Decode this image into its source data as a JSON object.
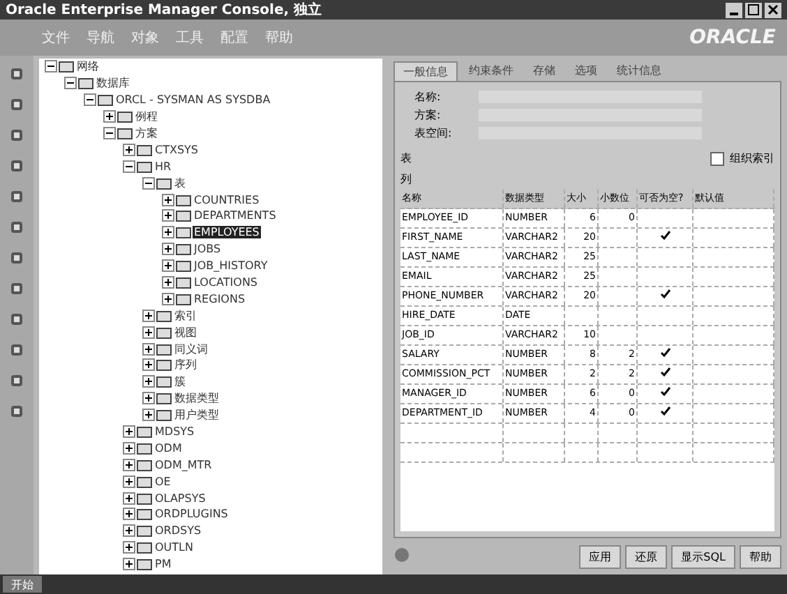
{
  "window": {
    "title": "Oracle Enterprise Manager Console, 独立"
  },
  "menu": [
    "文件",
    "导航",
    "对象",
    "工具",
    "配置",
    "帮助"
  ],
  "logo": "ORACLE",
  "tree": [
    {
      "label": "网络",
      "expanded": true,
      "selected": false,
      "children": [
        {
          "label": "数据库",
          "expanded": true,
          "selected": false,
          "children": [
            {
              "label": "ORCL - SYSMAN AS SYSDBA",
              "expanded": true,
              "selected": false,
              "children": [
                {
                  "label": "例程",
                  "expanded": false,
                  "selected": false
                },
                {
                  "label": "方案",
                  "expanded": true,
                  "selected": false,
                  "children": [
                    {
                      "label": "CTXSYS",
                      "expanded": false,
                      "selected": false
                    },
                    {
                      "label": "HR",
                      "expanded": true,
                      "selected": false,
                      "children": [
                        {
                          "label": "表",
                          "expanded": true,
                          "selected": false,
                          "children": [
                            {
                              "label": "COUNTRIES",
                              "expanded": false,
                              "selected": false
                            },
                            {
                              "label": "DEPARTMENTS",
                              "expanded": false,
                              "selected": false
                            },
                            {
                              "label": "EMPLOYEES",
                              "expanded": false,
                              "selected": true
                            },
                            {
                              "label": "JOBS",
                              "expanded": false,
                              "selected": false
                            },
                            {
                              "label": "JOB_HISTORY",
                              "expanded": false,
                              "selected": false
                            },
                            {
                              "label": "LOCATIONS",
                              "expanded": false,
                              "selected": false
                            },
                            {
                              "label": "REGIONS",
                              "expanded": false,
                              "selected": false
                            }
                          ]
                        },
                        {
                          "label": "索引",
                          "expanded": false,
                          "selected": false
                        },
                        {
                          "label": "视图",
                          "expanded": false,
                          "selected": false
                        },
                        {
                          "label": "同义词",
                          "expanded": false,
                          "selected": false
                        },
                        {
                          "label": "序列",
                          "expanded": false,
                          "selected": false
                        },
                        {
                          "label": "簇",
                          "expanded": false,
                          "selected": false
                        },
                        {
                          "label": "数据类型",
                          "expanded": false,
                          "selected": false
                        },
                        {
                          "label": "用户类型",
                          "expanded": false,
                          "selected": false
                        }
                      ]
                    },
                    {
                      "label": "MDSYS",
                      "expanded": false,
                      "selected": false
                    },
                    {
                      "label": "ODM",
                      "expanded": false,
                      "selected": false
                    },
                    {
                      "label": "ODM_MTR",
                      "expanded": false,
                      "selected": false
                    },
                    {
                      "label": "OE",
                      "expanded": false,
                      "selected": false
                    },
                    {
                      "label": "OLAPSYS",
                      "expanded": false,
                      "selected": false
                    },
                    {
                      "label": "ORDPLUGINS",
                      "expanded": false,
                      "selected": false
                    },
                    {
                      "label": "ORDSYS",
                      "expanded": false,
                      "selected": false
                    },
                    {
                      "label": "OUTLN",
                      "expanded": false,
                      "selected": false
                    },
                    {
                      "label": "PM",
                      "expanded": false,
                      "selected": false
                    }
                  ]
                }
              ]
            }
          ]
        }
      ]
    }
  ],
  "tabs": [
    {
      "label": "一般信息",
      "selected": true
    },
    {
      "label": "约束条件",
      "selected": false
    },
    {
      "label": "存储",
      "selected": false
    },
    {
      "label": "选项",
      "selected": false
    },
    {
      "label": "统计信息",
      "selected": false
    }
  ],
  "fields": [
    {
      "label": "名称:"
    },
    {
      "label": "方案:"
    },
    {
      "label": "表空间:"
    }
  ],
  "section_label": "表",
  "columns_label": "列",
  "org_checkbox": {
    "label": "组织索引",
    "checked": false
  },
  "table": {
    "columns": [
      "名称",
      "数据类型",
      "大小",
      "小数位",
      "可否为空?",
      "默认值"
    ],
    "rows": [
      {
        "name": "EMPLOYEE_ID",
        "type": "NUMBER",
        "size": "6",
        "scale": "0",
        "nullable": false
      },
      {
        "name": "FIRST_NAME",
        "type": "VARCHAR2",
        "size": "20",
        "scale": "",
        "nullable": true
      },
      {
        "name": "LAST_NAME",
        "type": "VARCHAR2",
        "size": "25",
        "scale": "",
        "nullable": false
      },
      {
        "name": "EMAIL",
        "type": "VARCHAR2",
        "size": "25",
        "scale": "",
        "nullable": false
      },
      {
        "name": "PHONE_NUMBER",
        "type": "VARCHAR2",
        "size": "20",
        "scale": "",
        "nullable": true
      },
      {
        "name": "HIRE_DATE",
        "type": "DATE",
        "size": "",
        "scale": "",
        "nullable": false
      },
      {
        "name": "JOB_ID",
        "type": "VARCHAR2",
        "size": "10",
        "scale": "",
        "nullable": false
      },
      {
        "name": "SALARY",
        "type": "NUMBER",
        "size": "8",
        "scale": "2",
        "nullable": true
      },
      {
        "name": "COMMISSION_PCT",
        "type": "NUMBER",
        "size": "2",
        "scale": "2",
        "nullable": true
      },
      {
        "name": "MANAGER_ID",
        "type": "NUMBER",
        "size": "6",
        "scale": "0",
        "nullable": true
      },
      {
        "name": "DEPARTMENT_ID",
        "type": "NUMBER",
        "size": "4",
        "scale": "0",
        "nullable": true
      }
    ]
  },
  "buttons": [
    "应用",
    "还原",
    "显示SQL"
  ],
  "help": "帮助",
  "taskbar": {
    "start": "开始"
  }
}
